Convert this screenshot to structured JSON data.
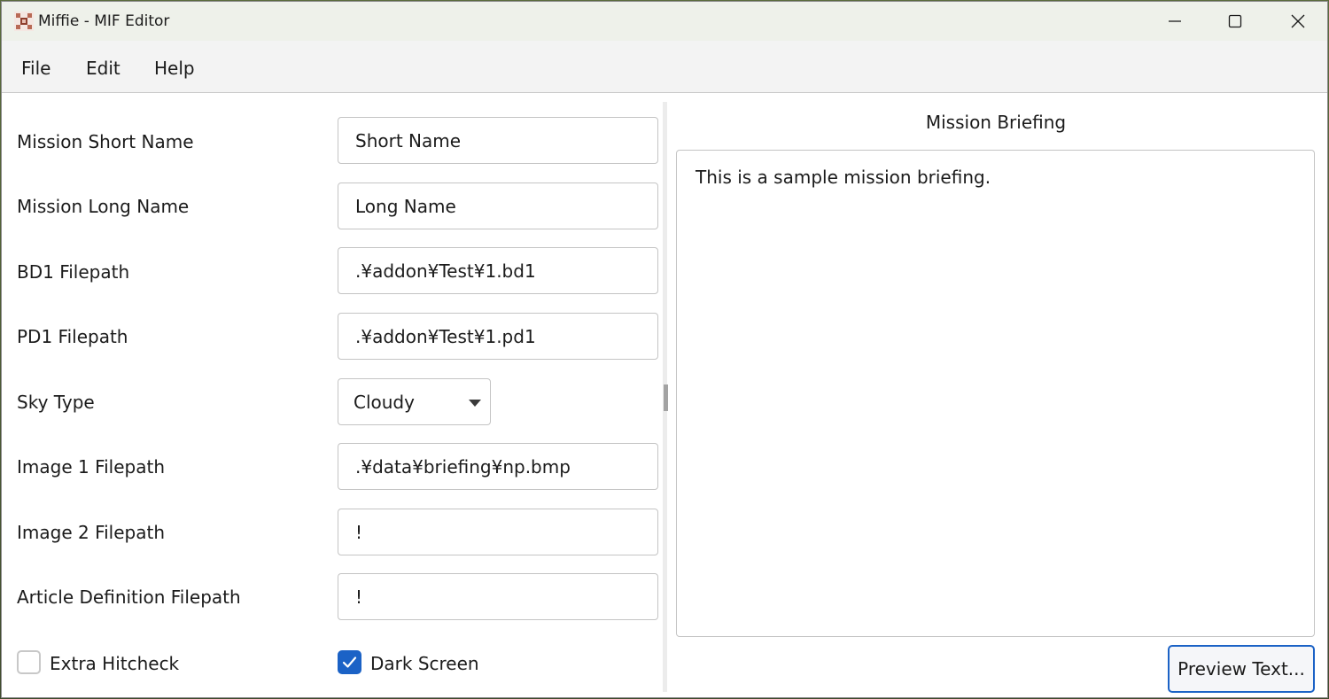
{
  "window": {
    "title": "Miffie - MIF Editor",
    "icon": "miffie-app-icon",
    "controls": {
      "minimize": "minimize-icon",
      "maximize": "maximize-icon",
      "close": "close-icon"
    }
  },
  "menu": {
    "items": [
      "File",
      "Edit",
      "Help"
    ]
  },
  "form": {
    "fields": [
      {
        "label": "Mission Short Name",
        "value": "Short Name"
      },
      {
        "label": "Mission Long Name",
        "value": "Long Name"
      },
      {
        "label": "BD1 Filepath",
        "value": ".¥addon¥Test¥1.bd1"
      },
      {
        "label": "PD1 Filepath",
        "value": ".¥addon¥Test¥1.pd1"
      },
      {
        "label": "Sky Type",
        "value": "Cloudy"
      },
      {
        "label": "Image 1 Filepath",
        "value": ".¥data¥briefing¥np.bmp"
      },
      {
        "label": "Image 2 Filepath",
        "value": "!"
      },
      {
        "label": "Article Definition Filepath",
        "value": "!"
      }
    ],
    "checkboxes": [
      {
        "label": "Extra Hitcheck",
        "checked": false
      },
      {
        "label": "Dark Screen",
        "checked": true
      }
    ]
  },
  "briefing": {
    "title": "Mission Briefing",
    "text": "This is a sample mission briefing.",
    "preview_button": "Preview Text..."
  },
  "colors": {
    "accent": "#1b62c6",
    "titlebar": "#eef1ea",
    "menubar": "#f3f3f3"
  }
}
